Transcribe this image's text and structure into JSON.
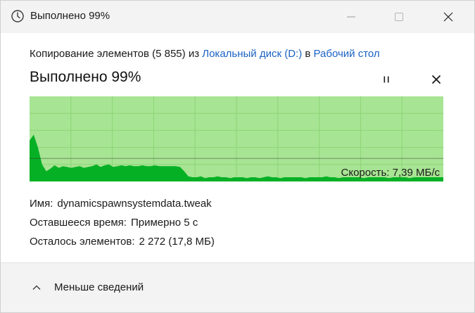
{
  "window": {
    "title": "Выполнено 99%"
  },
  "header": {
    "copy_prefix": "Копирование элементов (5 855) из ",
    "source": "Локальный диск (D:)",
    "connector": " в ",
    "destination": "Рабочий стол",
    "progress_title": "Выполнено 99%"
  },
  "chart_data": {
    "type": "area",
    "title": "",
    "xlabel": "",
    "ylabel": "",
    "progress_percent": 99,
    "speed_label": "Скорость: 7,39 МБ/с",
    "x": [
      0,
      1,
      2,
      3,
      4,
      5,
      6,
      7,
      8,
      9,
      10,
      11,
      12,
      13,
      14,
      15,
      16,
      17,
      18,
      19,
      20,
      21,
      22,
      23,
      24,
      25,
      26,
      27,
      28,
      29,
      30,
      31,
      32,
      33,
      34,
      35,
      36,
      37,
      38,
      39,
      40,
      41,
      42,
      43,
      44,
      45,
      46,
      47,
      48,
      49,
      50,
      51,
      52,
      53,
      54,
      55,
      56,
      57,
      58,
      59,
      60,
      61,
      62,
      63,
      64,
      65,
      66,
      67,
      68,
      69,
      70,
      71,
      72,
      73,
      74,
      75,
      76,
      77,
      78,
      79,
      80,
      81,
      82,
      83,
      84,
      85,
      86,
      87,
      88,
      89,
      90,
      91,
      92,
      93,
      94,
      95,
      96,
      97,
      98,
      99
    ],
    "values": [
      0.48,
      0.55,
      0.4,
      0.2,
      0.12,
      0.15,
      0.19,
      0.16,
      0.18,
      0.17,
      0.16,
      0.17,
      0.18,
      0.16,
      0.17,
      0.18,
      0.2,
      0.17,
      0.19,
      0.2,
      0.17,
      0.18,
      0.19,
      0.18,
      0.19,
      0.18,
      0.18,
      0.19,
      0.18,
      0.18,
      0.19,
      0.18,
      0.18,
      0.18,
      0.18,
      0.18,
      0.17,
      0.12,
      0.06,
      0.05,
      0.05,
      0.06,
      0.04,
      0.05,
      0.05,
      0.06,
      0.05,
      0.05,
      0.04,
      0.05,
      0.05,
      0.05,
      0.04,
      0.05,
      0.05,
      0.04,
      0.05,
      0.06,
      0.05,
      0.05,
      0.04,
      0.05,
      0.05,
      0.05,
      0.05,
      0.05,
      0.04,
      0.05,
      0.05,
      0.05,
      0.05,
      0.06,
      0.05,
      0.05,
      0.04,
      0.05,
      0.05,
      0.05,
      0.05,
      0.05,
      0.04,
      0.05,
      0.05,
      0.05,
      0.05,
      0.05,
      0.04,
      0.05,
      0.05,
      0.05,
      0.05,
      0.04,
      0.05,
      0.05,
      0.05,
      0.05,
      0.05,
      0.05,
      0.05,
      0.05
    ],
    "speed_level": 0.27,
    "ylim": [
      0,
      1
    ],
    "grid": true,
    "colors": {
      "remaining": "#a7e493",
      "completed_bg": "#a7e493",
      "area": "#06b025",
      "grid": "#8dd478",
      "speed_line": "#2a2a2a"
    }
  },
  "details": {
    "name_label": "Имя:",
    "name_value": "dynamicspawnsystemdata.tweak",
    "time_label": "Оставшееся время:",
    "time_value": "Примерно 5 с",
    "items_label": "Осталось элементов:",
    "items_value": "2 272 (17,8 МБ)"
  },
  "footer": {
    "less_details": "Меньше сведений"
  },
  "icons": {
    "title": "clock-icon",
    "minimize": "minimize-icon",
    "maximize": "maximize-icon",
    "close": "close-icon",
    "pause": "pause-icon",
    "cancel": "cancel-icon",
    "collapse": "chevron-up-icon"
  }
}
